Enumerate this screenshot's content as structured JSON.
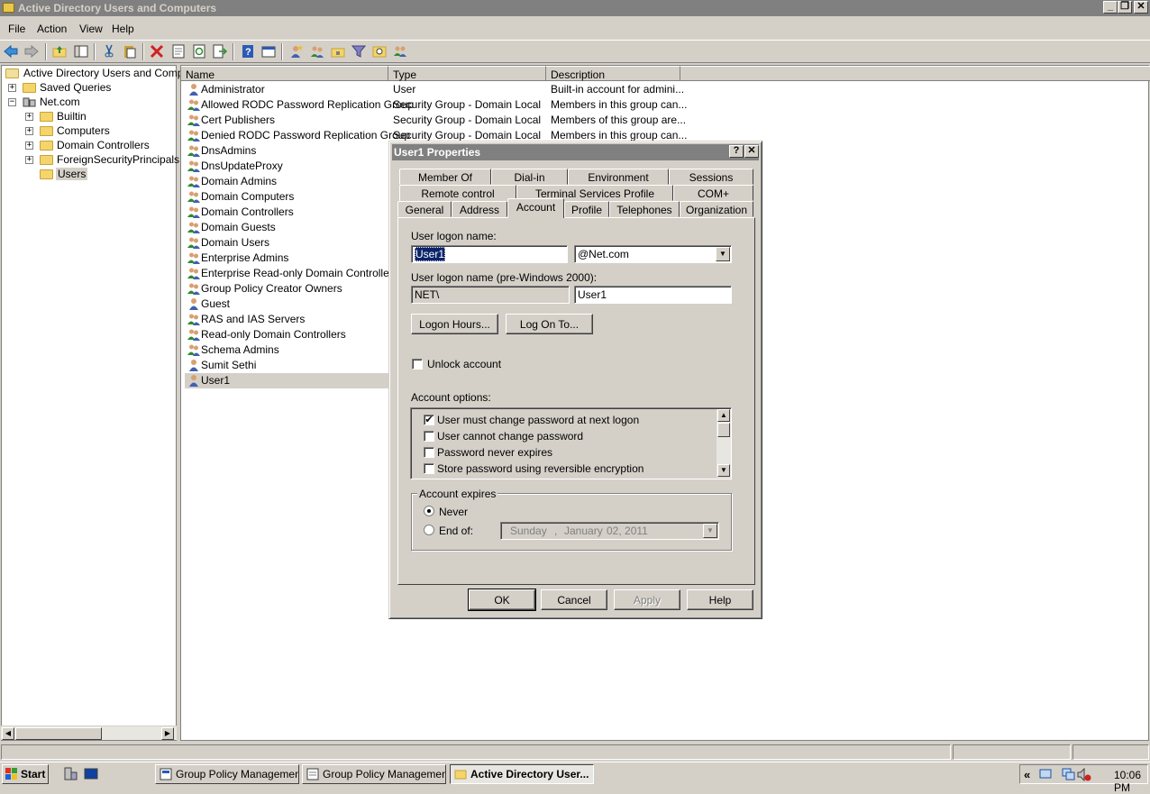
{
  "window": {
    "title": "Active Directory Users and Computers"
  },
  "menu": [
    "File",
    "Action",
    "View",
    "Help"
  ],
  "tree": {
    "root": "Active Directory Users and Comput",
    "items": [
      {
        "label": "Saved Queries"
      },
      {
        "label": "Net.com"
      },
      {
        "label": "Builtin"
      },
      {
        "label": "Computers"
      },
      {
        "label": "Domain Controllers"
      },
      {
        "label": "ForeignSecurityPrincipals"
      },
      {
        "label": "Users"
      }
    ]
  },
  "list": {
    "columns": [
      "Name",
      "Type",
      "Description"
    ],
    "rows": [
      {
        "name": "Administrator",
        "type": "User",
        "desc": "Built-in account for admini..."
      },
      {
        "name": "Allowed RODC Password Replication Group",
        "type": "Security Group - Domain Local",
        "desc": "Members in this group can..."
      },
      {
        "name": "Cert Publishers",
        "type": "Security Group - Domain Local",
        "desc": "Members of this group are..."
      },
      {
        "name": "Denied RODC Password Replication Group",
        "type": "Security Group - Domain Local",
        "desc": "Members in this group can..."
      },
      {
        "name": "DnsAdmins",
        "type": "",
        "desc": ""
      },
      {
        "name": "DnsUpdateProxy",
        "type": "",
        "desc": ""
      },
      {
        "name": "Domain Admins",
        "type": "",
        "desc": ""
      },
      {
        "name": "Domain Computers",
        "type": "",
        "desc": ""
      },
      {
        "name": "Domain Controllers",
        "type": "",
        "desc": ""
      },
      {
        "name": "Domain Guests",
        "type": "",
        "desc": ""
      },
      {
        "name": "Domain Users",
        "type": "",
        "desc": ""
      },
      {
        "name": "Enterprise Admins",
        "type": "",
        "desc": ""
      },
      {
        "name": "Enterprise Read-only Domain Controllers",
        "type": "",
        "desc": ""
      },
      {
        "name": "Group Policy Creator Owners",
        "type": "",
        "desc": ""
      },
      {
        "name": "Guest",
        "type": "",
        "desc": ""
      },
      {
        "name": "RAS and IAS Servers",
        "type": "",
        "desc": ""
      },
      {
        "name": "Read-only Domain Controllers",
        "type": "",
        "desc": ""
      },
      {
        "name": "Schema Admins",
        "type": "",
        "desc": ""
      },
      {
        "name": "Sumit Sethi",
        "type": "",
        "desc": ""
      },
      {
        "name": "User1",
        "type": "",
        "desc": ""
      }
    ]
  },
  "dialog": {
    "title": "User1 Properties",
    "help_glyph": "?",
    "tabs_row1": [
      "Member Of",
      "Dial-in",
      "Environment",
      "Sessions"
    ],
    "tabs_row2": [
      "Remote control",
      "Terminal Services Profile",
      "COM+"
    ],
    "tabs_row3": [
      "General",
      "Address",
      "Account",
      "Profile",
      "Telephones",
      "Organization"
    ],
    "logon_name_label": "User logon name:",
    "logon_name_value": "User1",
    "domain_suffix": "@Net.com",
    "pre2000_label": "User logon name (pre-Windows 2000):",
    "pre2000_domain": "NET\\",
    "pre2000_user": "User1",
    "logon_hours_button": "Logon Hours...",
    "log_on_to_button": "Log On To...",
    "unlock_label": "Unlock account",
    "account_options_label": "Account options:",
    "options": [
      {
        "label": "User must change password at next logon",
        "checked": true
      },
      {
        "label": "User cannot change password",
        "checked": false
      },
      {
        "label": "Password never expires",
        "checked": false
      },
      {
        "label": "Store password using reversible encryption",
        "checked": false
      }
    ],
    "expires_group": "Account expires",
    "never_label": "Never",
    "end_of_label": "End of:",
    "date_day": "Sunday",
    "date_sep": ",",
    "date_month": "January",
    "date_rest": "02, 2011",
    "ok": "OK",
    "cancel": "Cancel",
    "apply": "Apply",
    "help": "Help"
  },
  "taskbar": {
    "start": "Start",
    "buttons": [
      "Group Policy Management",
      "Group Policy Managemen...",
      "Active Directory User..."
    ],
    "chevron": "«",
    "clock": "10:06 PM"
  },
  "colors": {
    "selection": "#0a246a",
    "title_inactive": "#808080",
    "face": "#d4d0c8"
  }
}
